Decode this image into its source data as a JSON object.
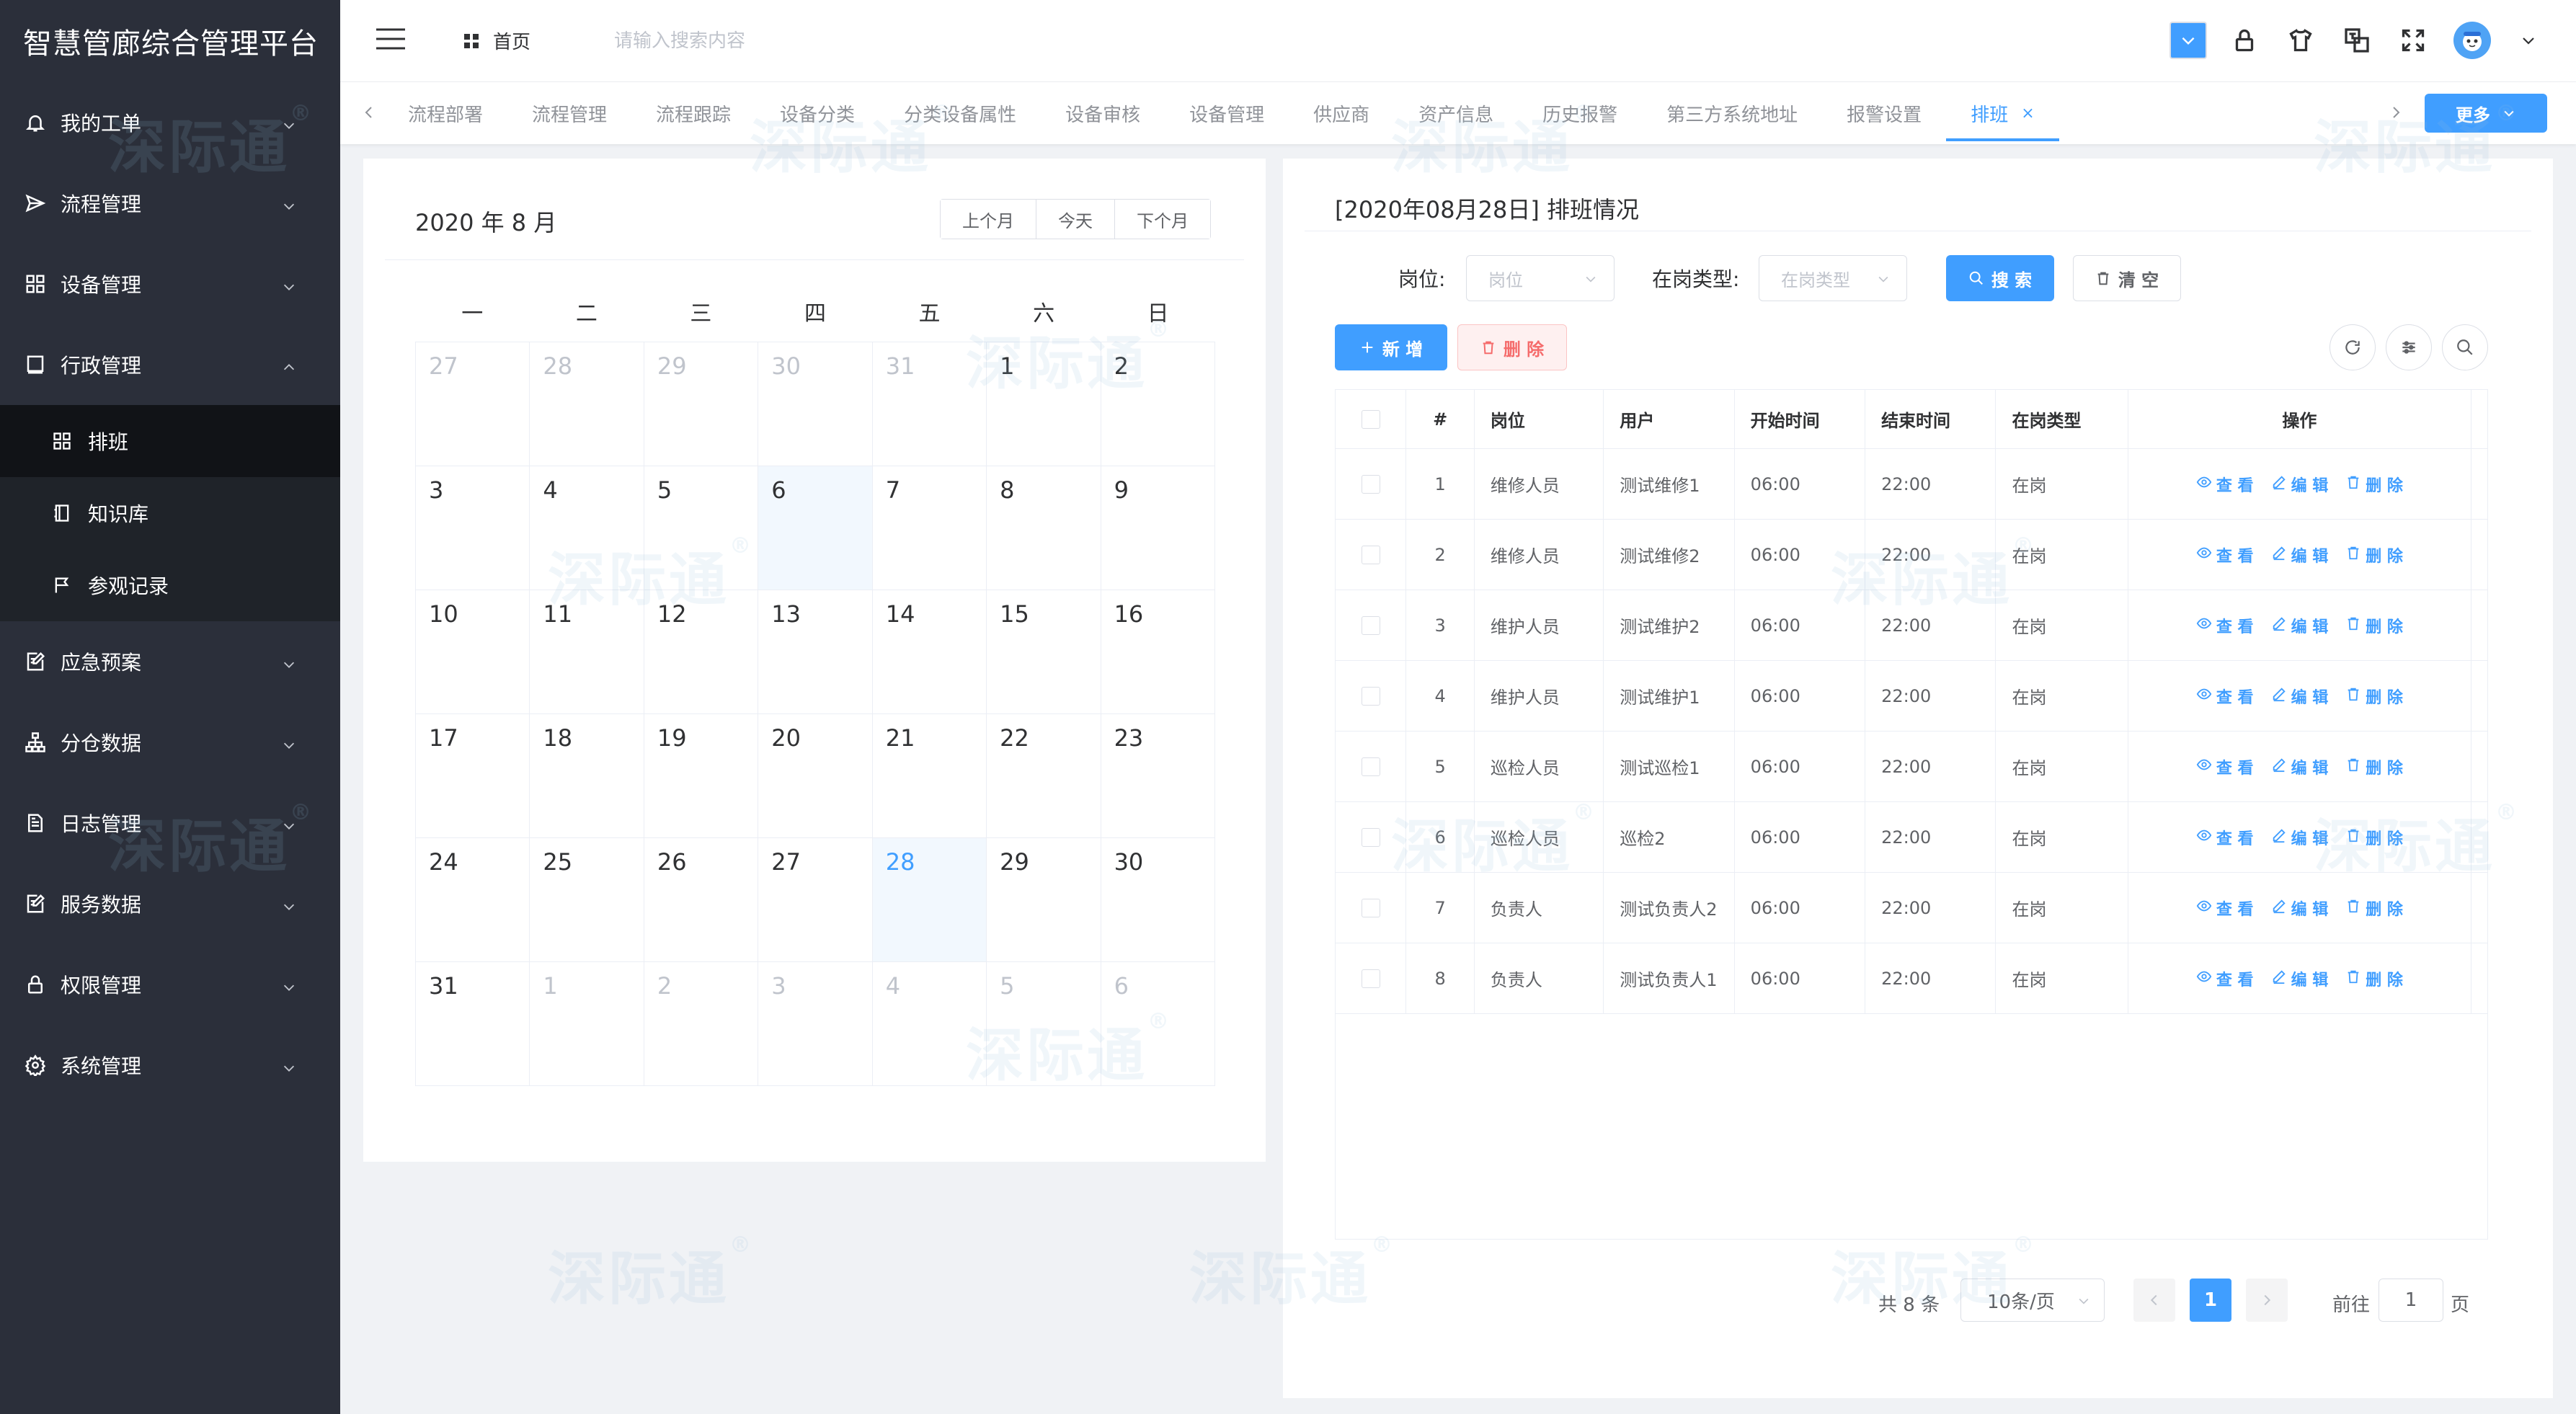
{
  "app": {
    "title": "智慧管廊综合管理平台"
  },
  "sidebar": {
    "items": [
      {
        "label": "我的工单",
        "icon": "bell-icon"
      },
      {
        "label": "流程管理",
        "icon": "send-icon"
      },
      {
        "label": "设备管理",
        "icon": "grid-icon"
      },
      {
        "label": "行政管理",
        "icon": "book-icon",
        "expanded": true
      },
      {
        "label": "应急预案",
        "icon": "edit-doc-icon"
      },
      {
        "label": "分仓数据",
        "icon": "org-tree-icon"
      },
      {
        "label": "日志管理",
        "icon": "log-doc-icon"
      },
      {
        "label": "服务数据",
        "icon": "edit-doc-icon"
      },
      {
        "label": "权限管理",
        "icon": "lock-icon"
      },
      {
        "label": "系统管理",
        "icon": "gear-icon"
      }
    ],
    "subitems": [
      {
        "label": "排班",
        "icon": "grid-icon",
        "active": true
      },
      {
        "label": "知识库",
        "icon": "notebook-icon"
      },
      {
        "label": "参观记录",
        "icon": "flag-icon"
      }
    ]
  },
  "header": {
    "home_label": "首页",
    "search_placeholder": "请输入搜索内容"
  },
  "tabs": {
    "items": [
      "流程部署",
      "流程管理",
      "流程跟踪",
      "设备分类",
      "分类设备属性",
      "设备审核",
      "设备管理",
      "供应商",
      "资产信息",
      "历史报警",
      "第三方系统地址",
      "报警设置",
      "排班"
    ],
    "active_index": 12,
    "close_symbol": "×",
    "more_label": "更多"
  },
  "calendar": {
    "title": "2020 年 8 月",
    "buttons": {
      "prev": "上个月",
      "today": "今天",
      "next": "下个月"
    },
    "weekdays": [
      "一",
      "二",
      "三",
      "四",
      "五",
      "六",
      "日"
    ],
    "days": [
      {
        "d": "27",
        "t": "prev"
      },
      {
        "d": "28",
        "t": "prev"
      },
      {
        "d": "29",
        "t": "prev"
      },
      {
        "d": "30",
        "t": "prev"
      },
      {
        "d": "31",
        "t": "prev"
      },
      {
        "d": "1",
        "t": "cur"
      },
      {
        "d": "2",
        "t": "cur"
      },
      {
        "d": "3",
        "t": "cur"
      },
      {
        "d": "4",
        "t": "cur"
      },
      {
        "d": "5",
        "t": "cur"
      },
      {
        "d": "6",
        "t": "hl"
      },
      {
        "d": "7",
        "t": "cur"
      },
      {
        "d": "8",
        "t": "cur"
      },
      {
        "d": "9",
        "t": "cur"
      },
      {
        "d": "10",
        "t": "cur"
      },
      {
        "d": "11",
        "t": "cur"
      },
      {
        "d": "12",
        "t": "cur"
      },
      {
        "d": "13",
        "t": "cur"
      },
      {
        "d": "14",
        "t": "cur"
      },
      {
        "d": "15",
        "t": "cur"
      },
      {
        "d": "16",
        "t": "cur"
      },
      {
        "d": "17",
        "t": "cur"
      },
      {
        "d": "18",
        "t": "cur"
      },
      {
        "d": "19",
        "t": "cur"
      },
      {
        "d": "20",
        "t": "cur"
      },
      {
        "d": "21",
        "t": "cur"
      },
      {
        "d": "22",
        "t": "cur"
      },
      {
        "d": "23",
        "t": "cur"
      },
      {
        "d": "24",
        "t": "cur"
      },
      {
        "d": "25",
        "t": "cur"
      },
      {
        "d": "26",
        "t": "cur"
      },
      {
        "d": "27",
        "t": "cur"
      },
      {
        "d": "28",
        "t": "today"
      },
      {
        "d": "29",
        "t": "cur"
      },
      {
        "d": "30",
        "t": "cur"
      },
      {
        "d": "31",
        "t": "cur"
      },
      {
        "d": "1",
        "t": "next"
      },
      {
        "d": "2",
        "t": "next"
      },
      {
        "d": "3",
        "t": "next"
      },
      {
        "d": "4",
        "t": "next"
      },
      {
        "d": "5",
        "t": "next"
      },
      {
        "d": "6",
        "t": "next"
      }
    ]
  },
  "schedule": {
    "title": "[2020年08月28日] 排班情况",
    "filters": {
      "post_label": "岗位:",
      "post_placeholder": "岗位",
      "type_label": "在岗类型:",
      "type_placeholder": "在岗类型",
      "search_button": "搜 索",
      "clear_button": "清 空"
    },
    "actions": {
      "add_button": "新 增",
      "delete_button": "删 除"
    },
    "columns": [
      "#",
      "岗位",
      "用户",
      "开始时间",
      "结束时间",
      "在岗类型",
      "操作"
    ],
    "row_actions": {
      "view": "查 看",
      "edit": "编 辑",
      "delete": "删 除"
    },
    "rows": [
      {
        "idx": "1",
        "post": "维修人员",
        "user": "测试维修1",
        "start": "06:00",
        "end": "22:00",
        "type": "在岗"
      },
      {
        "idx": "2",
        "post": "维修人员",
        "user": "测试维修2",
        "start": "06:00",
        "end": "22:00",
        "type": "在岗"
      },
      {
        "idx": "3",
        "post": "维护人员",
        "user": "测试维护2",
        "start": "06:00",
        "end": "22:00",
        "type": "在岗"
      },
      {
        "idx": "4",
        "post": "维护人员",
        "user": "测试维护1",
        "start": "06:00",
        "end": "22:00",
        "type": "在岗"
      },
      {
        "idx": "5",
        "post": "巡检人员",
        "user": "测试巡检1",
        "start": "06:00",
        "end": "22:00",
        "type": "在岗"
      },
      {
        "idx": "6",
        "post": "巡检人员",
        "user": "巡检2",
        "start": "06:00",
        "end": "22:00",
        "type": "在岗"
      },
      {
        "idx": "7",
        "post": "负责人",
        "user": "测试负责人2",
        "start": "06:00",
        "end": "22:00",
        "type": "在岗"
      },
      {
        "idx": "8",
        "post": "负责人",
        "user": "测试负责人1",
        "start": "06:00",
        "end": "22:00",
        "type": "在岗"
      }
    ],
    "pagination": {
      "total_label": "共 8 条",
      "page_size": "10条/页",
      "current_page": "1",
      "goto_label": "前往",
      "goto_value": "1",
      "page_suffix": "页"
    }
  },
  "watermark": {
    "text": "深际通",
    "mark": "®"
  },
  "colors": {
    "primary": "#409eff",
    "sidebar": "#2b2f3a",
    "danger": "#f56c6c"
  }
}
